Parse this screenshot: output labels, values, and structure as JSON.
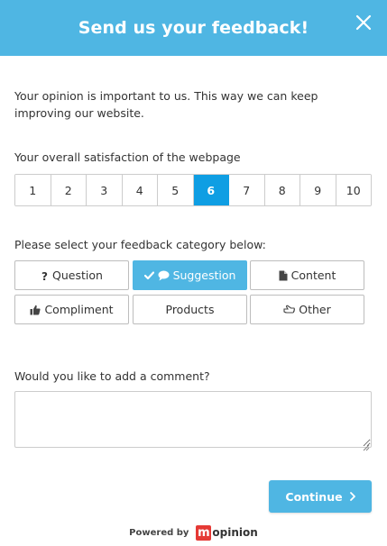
{
  "header": {
    "title": "Send us your feedback!"
  },
  "intro": {
    "text": "Your opinion is important to us. This way we can keep improving our website."
  },
  "satisfaction": {
    "label": "Your overall satisfaction of the webpage",
    "options": [
      "1",
      "2",
      "3",
      "4",
      "5",
      "6",
      "7",
      "8",
      "9",
      "10"
    ],
    "selected": "6"
  },
  "category": {
    "label": "Please select your feedback category below:",
    "options": [
      {
        "label": "Question",
        "icon": "question-icon"
      },
      {
        "label": "Suggestion",
        "icon": "comment-icon",
        "selected_icon": "check-icon"
      },
      {
        "label": "Content",
        "icon": "file-icon"
      },
      {
        "label": "Compliment",
        "icon": "thumbs-up-icon"
      },
      {
        "label": "Products",
        "icon": ""
      },
      {
        "label": "Other",
        "icon": "hand-pointer-icon"
      }
    ],
    "selected": "Suggestion"
  },
  "comment": {
    "label": "Would you like to add a comment?",
    "value": ""
  },
  "footer": {
    "continue_label": "Continue",
    "powered_by": "Powered by",
    "brand_mark": "m",
    "brand_name": "opinion"
  },
  "colors": {
    "header": "#4fb6e3",
    "scale_selected": "#0f9ee3",
    "category_selected": "#4fb6e3",
    "continue": "#4fb6e3",
    "brand_red": "#e53935"
  }
}
